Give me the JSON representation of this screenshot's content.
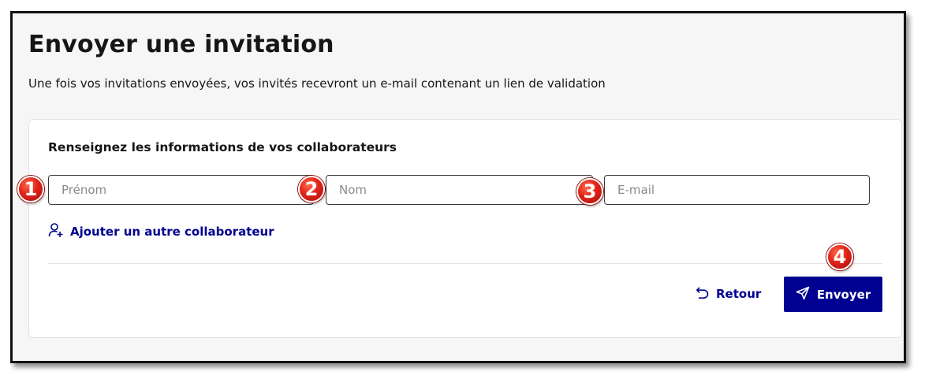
{
  "page": {
    "title": "Envoyer une invitation",
    "subtitle": "Une fois vos invitations envoyées, vos invités recevront un e-mail contenant un lien de validation"
  },
  "form": {
    "heading": "Renseignez les informations de vos collaborateurs",
    "fields": [
      {
        "placeholder": "Prénom",
        "value": ""
      },
      {
        "placeholder": "Nom",
        "value": ""
      },
      {
        "placeholder": "E-mail",
        "value": ""
      }
    ],
    "add_collaborator_label": "Ajouter un autre collaborateur",
    "add_collaborator_icon": "user-add-icon"
  },
  "actions": {
    "back_label": "Retour",
    "back_icon": "undo-arrow-icon",
    "send_label": "Envoyer",
    "send_icon": "send-icon"
  },
  "annotations": [
    "1",
    "2",
    "3",
    "4"
  ],
  "colors": {
    "primary": "#000091",
    "text": "#161616",
    "background": "#f6f6f6",
    "badge": "#e0241a"
  }
}
